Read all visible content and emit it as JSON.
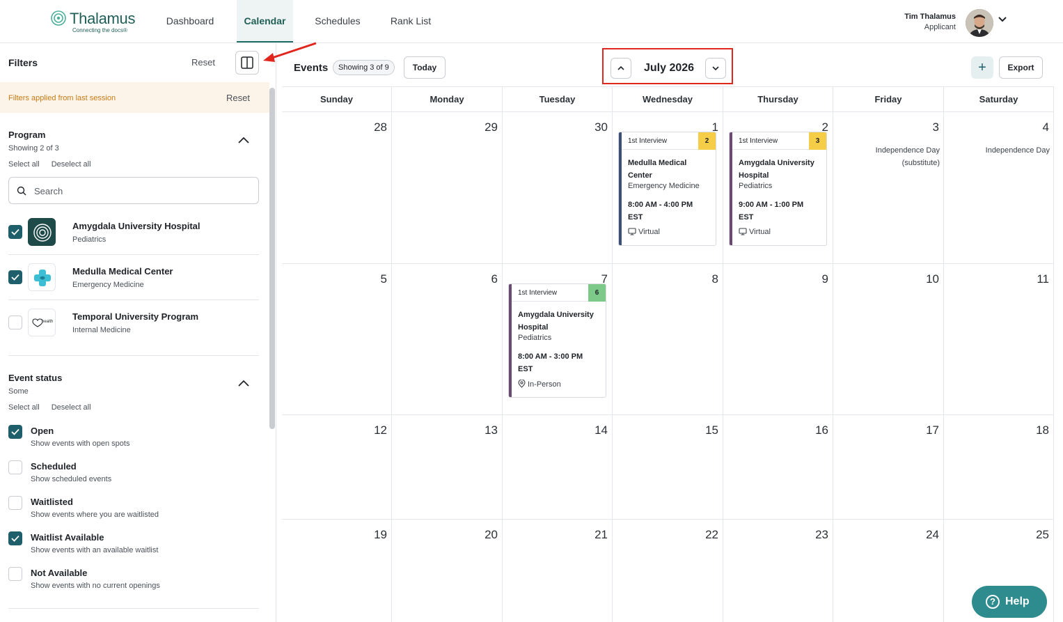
{
  "brand": {
    "name": "Thalamus",
    "tagline": "Connecting the docs®",
    "color": "#1f5f56"
  },
  "nav": {
    "tabs": [
      {
        "label": "Dashboard",
        "active": false
      },
      {
        "label": "Calendar",
        "active": true
      },
      {
        "label": "Schedules",
        "active": false
      },
      {
        "label": "Rank List",
        "active": false
      }
    ]
  },
  "user": {
    "name": "Tim Thalamus",
    "role": "Applicant",
    "menu_icon": "chevron-down-icon"
  },
  "filters": {
    "title": "Filters",
    "reset_label": "Reset",
    "toggle_icon": "sidebar-panel-icon",
    "banner": {
      "text": "Filters applied from last session",
      "reset_label": "Reset"
    },
    "program": {
      "title": "Program",
      "subtitle": "Showing 2 of 3",
      "select_all": "Select all",
      "deselect_all": "Deselect all",
      "search_placeholder": "Search",
      "items": [
        {
          "name": "Amygdala University Hospital",
          "specialty": "Pediatrics",
          "checked": true
        },
        {
          "name": "Medulla Medical Center",
          "specialty": "Emergency Medicine",
          "checked": true
        },
        {
          "name": "Temporal University Program",
          "specialty": "Internal Medicine",
          "checked": false,
          "logo_text": "health"
        }
      ]
    },
    "event_status": {
      "title": "Event status",
      "subtitle": "Some",
      "select_all": "Select all",
      "deselect_all": "Deselect all",
      "items": [
        {
          "label": "Open",
          "description": "Show events with open spots",
          "checked": true
        },
        {
          "label": "Scheduled",
          "description": "Show scheduled events",
          "checked": false
        },
        {
          "label": "Waitlisted",
          "description": "Show events where you are waitlisted",
          "checked": false
        },
        {
          "label": "Waitlist Available",
          "description": "Show events with an available waitlist",
          "checked": true
        },
        {
          "label": "Not Available",
          "description": "Show events with no current openings",
          "checked": false
        }
      ]
    }
  },
  "toolbar": {
    "title": "Events",
    "showing": "Showing 3 of 9",
    "today_label": "Today",
    "month_label": "July 2026",
    "add_label": "+",
    "export_label": "Export"
  },
  "calendar": {
    "weekdays": [
      "Sunday",
      "Monday",
      "Tuesday",
      "Wednesday",
      "Thursday",
      "Friday",
      "Saturday"
    ],
    "weeks": [
      [
        "28",
        "29",
        "30",
        "1",
        "2",
        "3",
        "4"
      ],
      [
        "5",
        "6",
        "7",
        "8",
        "9",
        "10",
        "11"
      ],
      [
        "12",
        "13",
        "14",
        "15",
        "16",
        "17",
        "18"
      ],
      [
        "19",
        "20",
        "21",
        "22",
        "23",
        "24",
        "25"
      ]
    ],
    "holidays": [
      {
        "week": 0,
        "day": 5,
        "label": "Independence Day (substitute)"
      },
      {
        "week": 0,
        "day": 6,
        "label": "Independence Day"
      }
    ],
    "events": [
      {
        "week": 0,
        "day": 3,
        "type": "1st Interview",
        "count": "2",
        "count_color": "#f5cd47",
        "bar_color": "#3b4f7a",
        "program": "Medulla Medical Center",
        "specialty": "Emergency Medicine",
        "time": "8:00 AM - 4:00 PM EST",
        "location": "Virtual",
        "location_icon": "monitor-icon"
      },
      {
        "week": 0,
        "day": 4,
        "type": "1st Interview",
        "count": "3",
        "count_color": "#f5cd47",
        "bar_color": "#6b4a72",
        "program": "Amygdala University Hospital",
        "specialty": "Pediatrics",
        "time": "9:00 AM - 1:00 PM EST",
        "location": "Virtual",
        "location_icon": "monitor-icon"
      },
      {
        "week": 1,
        "day": 2,
        "type": "1st Interview",
        "count": "6",
        "count_color": "#7cc98a",
        "bar_color": "#6b4a72",
        "program": "Amygdala University Hospital",
        "specialty": "Pediatrics",
        "time": "8:00 AM - 3:00 PM EST",
        "location": "In-Person",
        "location_icon": "map-pin-icon"
      }
    ]
  },
  "help": {
    "label": "Help",
    "color": "#2e8b8e"
  },
  "annotations": {
    "highlight_color": "#e0261d"
  }
}
